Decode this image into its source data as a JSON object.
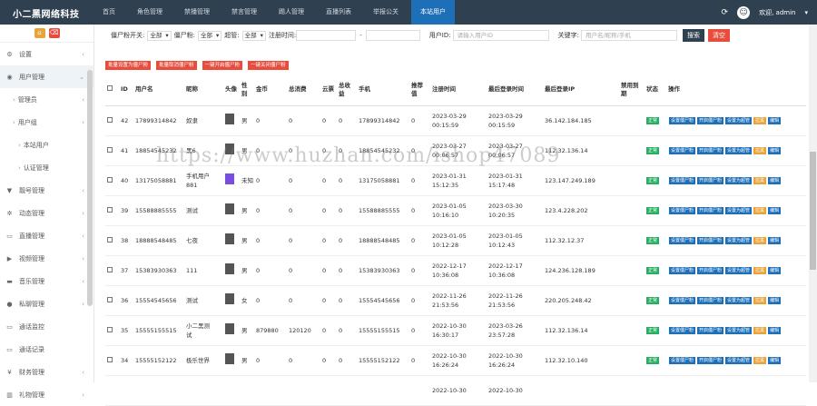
{
  "brand": "小二黑网络科技",
  "nav": [
    "首页",
    "角色管理",
    "禁播管理",
    "禁言管理",
    "踢人管理",
    "直播列表",
    "举报公关",
    "本站用户"
  ],
  "nav_active": 7,
  "user": "欢迎, admin",
  "sidebar": [
    {
      "label": "设置",
      "icon": "gear-icon",
      "glyph": "⚙",
      "arrow": "‹",
      "cls": ""
    },
    {
      "label": "用户管理",
      "icon": "users-icon",
      "glyph": "◉",
      "arrow": "⌄",
      "cls": "hl"
    },
    {
      "label": "管理员",
      "icon": "",
      "glyph": "",
      "arrow": "‹",
      "cls": "sub"
    },
    {
      "label": "用户组",
      "icon": "",
      "glyph": "",
      "arrow": "‹",
      "cls": "sub"
    },
    {
      "label": "本站用户",
      "icon": "",
      "glyph": "",
      "arrow": "",
      "cls": "sub2"
    },
    {
      "label": "认证管理",
      "icon": "",
      "glyph": "",
      "arrow": "",
      "cls": "sub2"
    },
    {
      "label": "靓号管理",
      "icon": "tag-icon",
      "glyph": "▼",
      "arrow": "‹",
      "cls": ""
    },
    {
      "label": "动态管理",
      "icon": "gear2-icon",
      "glyph": "✲",
      "arrow": "‹",
      "cls": ""
    },
    {
      "label": "直播管理",
      "icon": "monitor-icon",
      "glyph": "▭",
      "arrow": "‹",
      "cls": ""
    },
    {
      "label": "视频管理",
      "icon": "video-icon",
      "glyph": "▶",
      "arrow": "‹",
      "cls": ""
    },
    {
      "label": "音乐管理",
      "icon": "music-icon",
      "glyph": "▬",
      "arrow": "‹",
      "cls": ""
    },
    {
      "label": "私聊管理",
      "icon": "message-icon",
      "glyph": "●",
      "arrow": "‹",
      "cls": ""
    },
    {
      "label": "通话监控",
      "icon": "call-monitor-icon",
      "glyph": "▭",
      "arrow": "",
      "cls": ""
    },
    {
      "label": "通话记录",
      "icon": "call-log-icon",
      "glyph": "▭",
      "arrow": "",
      "cls": ""
    },
    {
      "label": "财务管理",
      "icon": "finance-icon",
      "glyph": "¥",
      "arrow": "‹",
      "cls": ""
    },
    {
      "label": "礼物管理",
      "icon": "gift-icon",
      "glyph": "▥",
      "arrow": "‹",
      "cls": ""
    }
  ],
  "filters": {
    "vip_label": "僵尸粉开关:",
    "vip_value": "全部",
    "fan_label": "僵尸粉:",
    "fan_value": "全部",
    "super_label": "超管:",
    "super_value": "全部",
    "reg_label": "注册时间:",
    "reg_sep": "-",
    "uid_label": "用户ID:",
    "uid_placeholder": "请输入用户ID",
    "kw_label": "关键字:",
    "kw_placeholder": "用户名/昵称/手机",
    "search": "搜索",
    "reset": "清空"
  },
  "actions": [
    "批量设置为僵尸粉",
    "批量取消僵尸粉",
    "一键开启僵尸粉",
    "一键关闭僵尸粉"
  ],
  "columns": [
    "ID",
    "用户名",
    "昵称",
    "头像",
    "性别",
    "金币",
    "总消费",
    "云票",
    "总收益",
    "手机",
    "推荐值",
    "注册时间",
    "最后登录时间",
    "最后登录IP",
    "禁用到期",
    "状态",
    "操作"
  ],
  "status": "正常",
  "op_labels": [
    "设置僵尸粉",
    "开启僵尸粉",
    "设置为超管",
    "拉黑",
    "编辑"
  ],
  "rows": [
    {
      "id": "42",
      "user": "17899314842",
      "nick": "奴隶",
      "sex": "男",
      "coin": "0",
      "spend": "0",
      "ticket": "0",
      "income": "0",
      "phone": "17899314842",
      "rec": "0",
      "reg": [
        "2023-03-29",
        "00:15:59"
      ],
      "last": [
        "2023-03-29",
        "00:15:59"
      ],
      "ip": "36.142.184.185",
      "thumb": "dark"
    },
    {
      "id": "41",
      "user": "18854545232",
      "nick": "黑6",
      "sex": "男",
      "coin": "0",
      "spend": "0",
      "ticket": "0",
      "income": "0",
      "phone": "18854545232",
      "rec": "0",
      "reg": [
        "2023-03-27",
        "00:06:57"
      ],
      "last": [
        "2023-03-27",
        "00:06:57"
      ],
      "ip": "112.32.136.14",
      "thumb": "dark"
    },
    {
      "id": "40",
      "user": "13175058881",
      "nick": "手机用户\n881",
      "sex": "未知",
      "coin": "0",
      "spend": "0",
      "ticket": "0",
      "income": "0",
      "phone": "13175058881",
      "rec": "0",
      "reg": [
        "2023-01-31",
        "15:12:35"
      ],
      "last": [
        "2023-01-31",
        "15:17:48"
      ],
      "ip": "123.147.249.189",
      "thumb": "purple"
    },
    {
      "id": "39",
      "user": "15588885555",
      "nick": "测试",
      "sex": "男",
      "coin": "0",
      "spend": "0",
      "ticket": "0",
      "income": "0",
      "phone": "15588885555",
      "rec": "0",
      "reg": [
        "2023-01-05",
        "10:16:10"
      ],
      "last": [
        "2023-03-30",
        "10:20:35"
      ],
      "ip": "123.4.228.202",
      "thumb": "dark"
    },
    {
      "id": "38",
      "user": "18888548485",
      "nick": "七夜",
      "sex": "男",
      "coin": "0",
      "spend": "0",
      "ticket": "0",
      "income": "0",
      "phone": "18888548485",
      "rec": "0",
      "reg": [
        "2023-01-05",
        "10:12:28"
      ],
      "last": [
        "2023-01-05",
        "10:12:43"
      ],
      "ip": "112.32.12.37",
      "thumb": "dark"
    },
    {
      "id": "37",
      "user": "15383930363",
      "nick": "111",
      "sex": "男",
      "coin": "0",
      "spend": "0",
      "ticket": "0",
      "income": "0",
      "phone": "15383930363",
      "rec": "0",
      "reg": [
        "2022-12-17",
        "10:36:08"
      ],
      "last": [
        "2022-12-17",
        "10:36:08"
      ],
      "ip": "124.236.128.189",
      "thumb": "dark"
    },
    {
      "id": "36",
      "user": "15554545656",
      "nick": "测试",
      "sex": "女",
      "coin": "0",
      "spend": "0",
      "ticket": "0",
      "income": "0",
      "phone": "15554545656",
      "rec": "0",
      "reg": [
        "2022-11-26",
        "21:53:56"
      ],
      "last": [
        "2022-11-26",
        "21:53:56"
      ],
      "ip": "220.205.248.42",
      "thumb": "dark"
    },
    {
      "id": "35",
      "user": "15555155515",
      "nick": "小二黑测\n试",
      "sex": "男",
      "coin": "879880",
      "spend": "120120",
      "ticket": "0",
      "income": "0",
      "phone": "15555155515",
      "rec": "0",
      "reg": [
        "2022-10-30",
        "16:30:17"
      ],
      "last": [
        "2023-03-26",
        "23:57:28"
      ],
      "ip": "112.32.136.14",
      "thumb": "dark"
    },
    {
      "id": "34",
      "user": "15555152122",
      "nick": "极乐世界",
      "sex": "男",
      "coin": "0",
      "spend": "0",
      "ticket": "0",
      "income": "0",
      "phone": "15555152122",
      "rec": "0",
      "reg": [
        "2022-10-30",
        "16:26:24"
      ],
      "last": [
        "2022-10-30",
        "16:26:24"
      ],
      "ip": "112.32.10.140",
      "thumb": "dark"
    },
    {
      "id": "",
      "user": "",
      "nick": "",
      "sex": "",
      "coin": "",
      "spend": "",
      "ticket": "",
      "income": "",
      "phone": "",
      "rec": "",
      "reg": [
        "2022-10-30",
        ""
      ],
      "last": [
        "2022-10-30",
        ""
      ],
      "ip": "",
      "thumb": "none"
    }
  ],
  "watermark": "https://www.huzhan.com/ishop47089",
  "colors": {
    "topbar": "#2f4050",
    "active": "#1d6fb8",
    "danger": "#e74c3c",
    "success": "#27ae60",
    "warn": "#e8a33b"
  }
}
